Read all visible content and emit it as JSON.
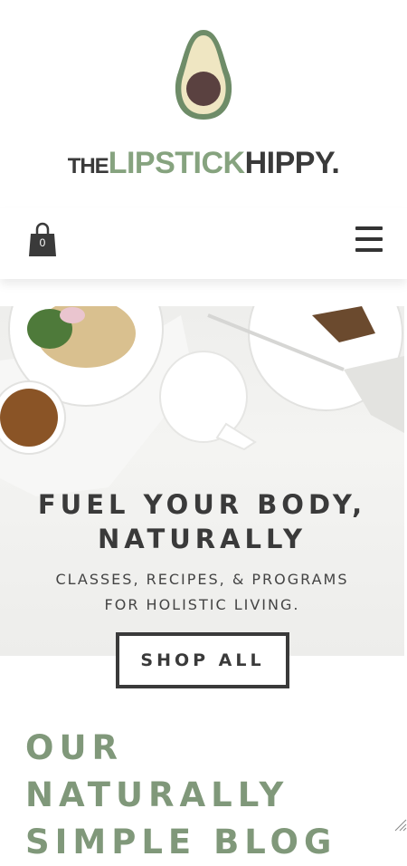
{
  "brand": {
    "prefix": "THE",
    "middle": "LIPSTICK",
    "suffix": "HIPPY."
  },
  "cart": {
    "count": "0"
  },
  "hero": {
    "title_line1": "FUEL YOUR BODY,",
    "title_line2": "NATURALLY",
    "subtitle_line1": "CLASSES, RECIPES, & PROGRAMS",
    "subtitle_line2": "FOR HOLISTIC LIVING."
  },
  "cta": {
    "shop_all": "SHOP ALL"
  },
  "blog": {
    "line1": "OUR",
    "line2": "NATURALLY",
    "line3": "SIMPLE BLOG"
  },
  "icons": [
    "avocado-logo-icon",
    "shopping-bag-icon",
    "hamburger-menu-icon",
    "resize-grip-icon"
  ],
  "colors": {
    "accent_green": "#86a37f",
    "dark": "#3a3a3a",
    "avocado_skin": "#6e8c68",
    "avocado_flesh": "#efe6c2",
    "avocado_pit": "#5a4140"
  }
}
